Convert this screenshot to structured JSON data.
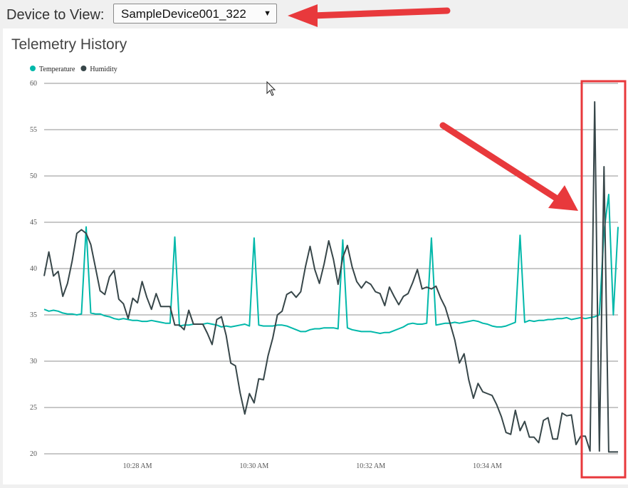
{
  "device": {
    "label": "Device to View:",
    "selected": "SampleDevice001_322"
  },
  "panel": {
    "title": "Telemetry History"
  },
  "colors": {
    "temperature": "#01b8aa",
    "humidity": "#374649",
    "annotation": "#e8393c"
  },
  "chart_data": {
    "type": "line",
    "title": "Telemetry History",
    "legend": [
      "Temperature",
      "Humidity"
    ],
    "legend_position": "top-left",
    "ylim": [
      20,
      60
    ],
    "yticks": [
      20,
      25,
      30,
      35,
      40,
      45,
      50,
      55,
      60
    ],
    "x_tick_labels": [
      "10:28 AM",
      "10:30 AM",
      "10:32 AM",
      "10:34 AM"
    ],
    "x_tick_indices": [
      20,
      45,
      70,
      95
    ],
    "x_count": 124,
    "grid": true,
    "series": [
      {
        "name": "Temperature",
        "values": [
          35.6,
          35.4,
          35.5,
          35.4,
          35.2,
          35.1,
          35.1,
          35.0,
          35.1,
          44.5,
          35.2,
          35.1,
          35.1,
          34.9,
          34.8,
          34.6,
          34.5,
          34.6,
          34.5,
          34.4,
          34.4,
          34.3,
          34.3,
          34.4,
          34.3,
          34.2,
          34.1,
          34.1,
          43.4,
          33.8,
          33.9,
          33.9,
          34.0,
          34.0,
          34.0,
          34.1,
          34.0,
          33.9,
          33.7,
          33.8,
          33.7,
          33.8,
          33.9,
          34.0,
          33.8,
          43.3,
          33.9,
          33.8,
          33.8,
          33.8,
          33.9,
          33.9,
          33.8,
          33.6,
          33.4,
          33.2,
          33.2,
          33.4,
          33.5,
          33.5,
          33.6,
          33.6,
          33.6,
          33.5,
          43.1,
          33.6,
          33.4,
          33.3,
          33.2,
          33.2,
          33.2,
          33.1,
          33.0,
          33.1,
          33.1,
          33.3,
          33.5,
          33.7,
          34.0,
          34.1,
          34.0,
          34.0,
          34.1,
          43.3,
          33.9,
          34.0,
          34.1,
          34.1,
          34.2,
          34.1,
          34.2,
          34.3,
          34.4,
          34.3,
          34.1,
          34.0,
          33.8,
          33.7,
          33.7,
          33.8,
          34.0,
          34.2,
          43.6,
          34.2,
          34.4,
          34.3,
          34.4,
          34.4,
          34.5,
          34.5,
          34.6,
          34.6,
          34.7,
          34.5,
          34.6,
          34.7,
          34.6,
          34.7,
          34.8,
          35.0,
          44.0,
          48.0,
          35.0,
          44.5
        ],
        "color": "#01b8aa"
      },
      {
        "name": "Humidity",
        "values": [
          39.2,
          41.8,
          39.2,
          39.7,
          37.0,
          38.4,
          40.8,
          43.8,
          44.2,
          43.8,
          42.6,
          40.1,
          37.6,
          37.2,
          39.1,
          39.8,
          36.7,
          36.2,
          34.6,
          36.8,
          36.3,
          38.6,
          36.9,
          35.6,
          37.3,
          35.9,
          35.9,
          35.9,
          33.9,
          33.9,
          33.4,
          35.5,
          34.0,
          34.0,
          34.0,
          33.0,
          31.8,
          34.5,
          34.8,
          32.8,
          29.8,
          29.5,
          26.6,
          24.3,
          26.5,
          25.5,
          28.1,
          28.0,
          30.6,
          32.5,
          35.0,
          35.4,
          37.2,
          37.5,
          36.9,
          37.5,
          40.2,
          42.4,
          39.9,
          38.4,
          40.5,
          43.0,
          41.0,
          38.3,
          41.2,
          42.5,
          40.2,
          38.6,
          37.9,
          38.6,
          38.3,
          37.5,
          37.3,
          36.0,
          38.0,
          37.0,
          36.1,
          37.0,
          37.3,
          38.5,
          39.9,
          37.8,
          38.0,
          37.8,
          38.1,
          36.8,
          35.8,
          34.1,
          32.3,
          29.8,
          30.8,
          28.0,
          26.0,
          27.6,
          26.7,
          26.5,
          26.3,
          25.3,
          24.0,
          22.3,
          22.1,
          24.7,
          22.5,
          23.5,
          21.8,
          21.8,
          21.2,
          23.6,
          23.9,
          21.6,
          21.6,
          24.4,
          24.1,
          24.2,
          21.0,
          21.9,
          21.9,
          20.3,
          58.0,
          20.3,
          51.0,
          20.2,
          20.2,
          20.2
        ]
      }
    ]
  }
}
